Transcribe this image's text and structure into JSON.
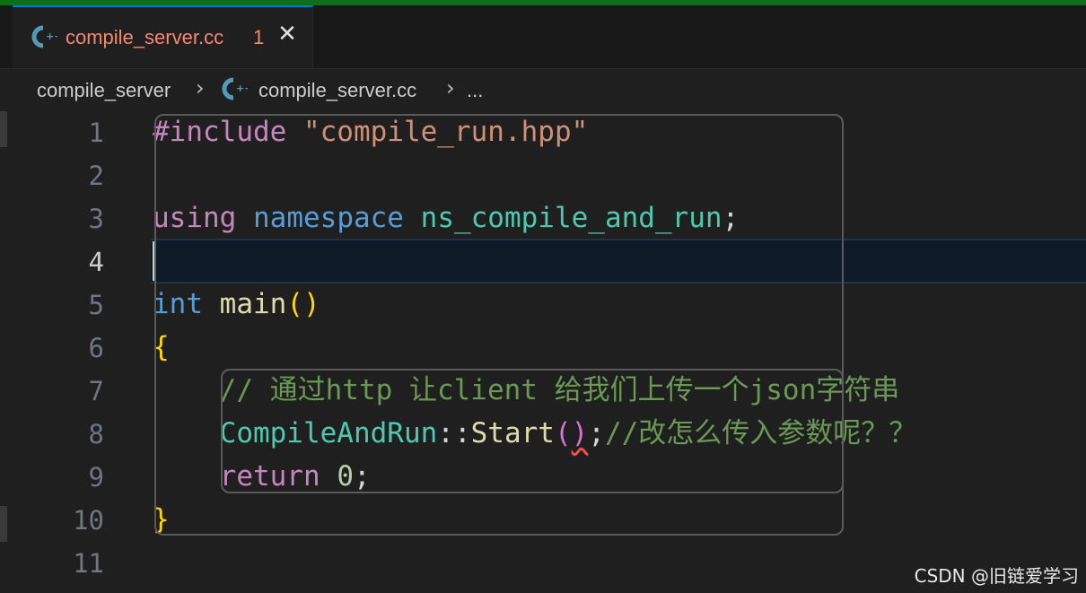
{
  "tab": {
    "filename": "compile_server.cc",
    "problem_count": "1",
    "close_glyph": "✕"
  },
  "breadcrumb": {
    "folder": "compile_server",
    "file": "compile_server.cc",
    "more": "..."
  },
  "gutter": {
    "line_numbers": [
      "1",
      "2",
      "3",
      "4",
      "5",
      "6",
      "7",
      "8",
      "9",
      "10",
      "11"
    ],
    "active_line": 4
  },
  "code": {
    "l1": {
      "directive": "#include",
      "space": " ",
      "path": "\"compile_run.hpp\""
    },
    "l3": {
      "using": "using",
      "sp1": " ",
      "namespace": "namespace",
      "sp2": " ",
      "name": "ns_compile_and_run",
      "semi": ";"
    },
    "l5": {
      "type": "int",
      "sp": " ",
      "fn": "main",
      "parens": "()"
    },
    "l6": {
      "brace": "{"
    },
    "l7": {
      "indent": "    ",
      "comment": "// 通过http 让client 给我们上传一个json字符串"
    },
    "l8": {
      "indent": "    ",
      "cls": "CompileAndRun",
      "scope": "::",
      "fn": "Start",
      "open": "(",
      "close": ")",
      "semi": ";",
      "comment": "//改怎么传入参数呢？？"
    },
    "l9": {
      "indent": "    ",
      "kw": "return",
      "sp": " ",
      "num": "0",
      "semi": ";"
    },
    "l10": {
      "brace": "}"
    }
  },
  "icons": {
    "tab_file": "cpp-file-icon",
    "breadcrumb_file": "cpp-file-icon",
    "close": "close-icon",
    "chevron": "chevron-right-icon"
  },
  "colors": {
    "accent": "#0078d4",
    "error_tab": "#f48771",
    "background": "#1f1f1f"
  },
  "watermark": "CSDN @旧链爱学习"
}
